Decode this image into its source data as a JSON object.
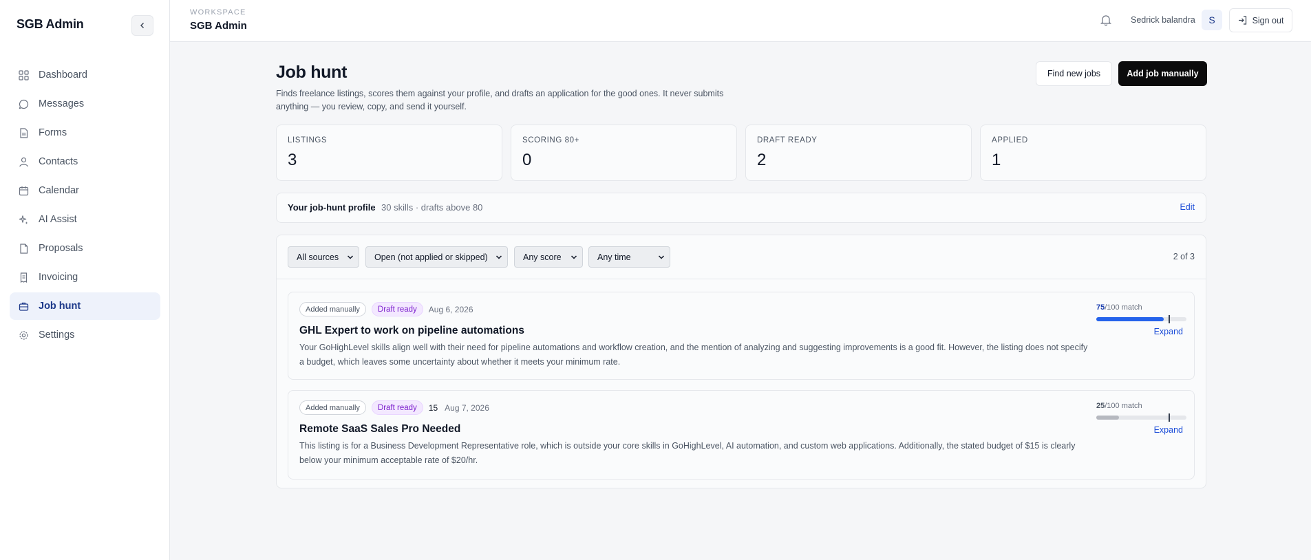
{
  "sidebar": {
    "brand": "SGB Admin",
    "items": [
      {
        "label": "Dashboard",
        "icon": "grid-icon"
      },
      {
        "label": "Messages",
        "icon": "message-icon"
      },
      {
        "label": "Forms",
        "icon": "document-icon"
      },
      {
        "label": "Contacts",
        "icon": "user-icon"
      },
      {
        "label": "Calendar",
        "icon": "calendar-icon"
      },
      {
        "label": "AI Assist",
        "icon": "sparkle-icon"
      },
      {
        "label": "Proposals",
        "icon": "file-icon"
      },
      {
        "label": "Invoicing",
        "icon": "receipt-icon"
      },
      {
        "label": "Job hunt",
        "icon": "briefcase-icon",
        "active": true
      },
      {
        "label": "Settings",
        "icon": "gear-icon"
      }
    ]
  },
  "topbar": {
    "workspace_label": "WORKSPACE",
    "workspace_name": "SGB Admin",
    "user_name": "Sedrick balandra",
    "avatar_initial": "S",
    "signout_label": "Sign out"
  },
  "page": {
    "title": "Job hunt",
    "description": "Finds freelance listings, scores them against your profile, and drafts an application for the good ones. It never submits anything — you review, copy, and send it yourself.",
    "find_button": "Find new jobs",
    "add_button": "Add job manually"
  },
  "stats": [
    {
      "label": "LISTINGS",
      "value": "3"
    },
    {
      "label": "SCORING 80+",
      "value": "0"
    },
    {
      "label": "DRAFT READY",
      "value": "2"
    },
    {
      "label": "APPLIED",
      "value": "1"
    }
  ],
  "profile": {
    "title": "Your job-hunt profile",
    "meta": "30 skills · drafts above 80",
    "edit_label": "Edit"
  },
  "filters": {
    "source": "All sources",
    "status": "Open (not applied or skipped)",
    "score": "Any score",
    "time": "Any time",
    "count": "2 of 3"
  },
  "jobs": [
    {
      "source_tag": "Added manually",
      "status_tag": "Draft ready",
      "extra": "",
      "date": "Aug 6, 2026",
      "title": "GHL Expert to work on pipeline automations",
      "description": "Your GoHighLevel skills align well with their need for pipeline automations and workflow creation, and the mention of analyzing and suggesting improvements is a good fit. However, the listing does not specify a budget, which leaves some uncertainty about whether it meets your minimum rate.",
      "score": "75",
      "score_suffix": "/100 match",
      "score_fraction": 0.75,
      "threshold_fraction": 0.8,
      "bar_color": "#2563eb",
      "score_color": "#1e40af",
      "expand_label": "Expand"
    },
    {
      "source_tag": "Added manually",
      "status_tag": "Draft ready",
      "extra": "15",
      "date": "Aug 7, 2026",
      "title": "Remote SaaS Sales Pro Needed",
      "description": "This listing is for a Business Development Representative role, which is outside your core skills in GoHighLevel, AI automation, and custom web applications. Additionally, the stated budget of $15 is clearly below your minimum acceptable rate of $20/hr.",
      "score": "25",
      "score_suffix": "/100 match",
      "score_fraction": 0.25,
      "threshold_fraction": 0.8,
      "bar_color": "#b5b8bf",
      "score_color": "#4b5563",
      "expand_label": "Expand"
    }
  ]
}
